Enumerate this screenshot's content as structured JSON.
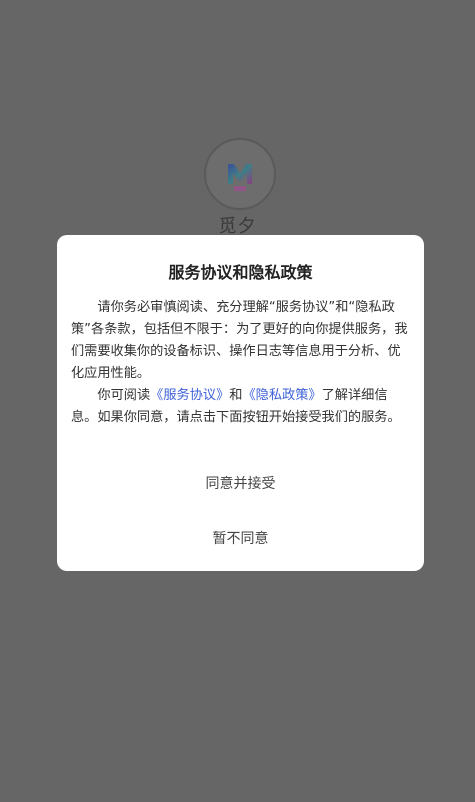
{
  "app": {
    "name": "觅夕",
    "logo_icon": "m-logo-icon",
    "logo_badge_text": "觅夕"
  },
  "dialog": {
    "title": "服务协议和隐私政策",
    "para1": "请你务必审慎阅读、充分理解“服务协议”和“隐私政策”各条款，包括但不限于：为了更好的向你提供服务，我们需要收集你的设备标识、操作日志等信息用于分析、优化应用性能。",
    "para2_prefix": "你可阅读",
    "link_terms": "《服务协议》",
    "para2_and": "和",
    "link_privacy": "《隐私政策》",
    "para2_suffix": "了解详细信息。如果你同意，请点击下面按钮开始接受我们的服务。",
    "accept_label": "同意并接受",
    "decline_label": "暂不同意"
  },
  "colors": {
    "backdrop": "#666666",
    "dialog_bg": "#ffffff",
    "link": "#3e62d8"
  }
}
